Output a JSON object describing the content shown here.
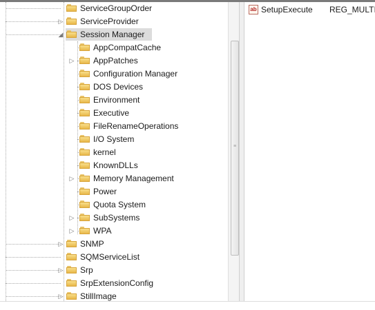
{
  "tree": {
    "items": [
      {
        "label": "ServiceGroupOrder",
        "level": 1,
        "expander": ""
      },
      {
        "label": "ServiceProvider",
        "level": 1,
        "expander": "▷"
      },
      {
        "label": "Session Manager",
        "level": 1,
        "expander": "◢",
        "selected": true
      },
      {
        "label": "AppCompatCache",
        "level": 2,
        "expander": ""
      },
      {
        "label": "AppPatches",
        "level": 2,
        "expander": "▷"
      },
      {
        "label": "Configuration Manager",
        "level": 2,
        "expander": ""
      },
      {
        "label": "DOS Devices",
        "level": 2,
        "expander": ""
      },
      {
        "label": "Environment",
        "level": 2,
        "expander": ""
      },
      {
        "label": "Executive",
        "level": 2,
        "expander": ""
      },
      {
        "label": "FileRenameOperations",
        "level": 2,
        "expander": ""
      },
      {
        "label": "I/O System",
        "level": 2,
        "expander": ""
      },
      {
        "label": "kernel",
        "level": 2,
        "expander": ""
      },
      {
        "label": "KnownDLLs",
        "level": 2,
        "expander": ""
      },
      {
        "label": "Memory Management",
        "level": 2,
        "expander": "▷"
      },
      {
        "label": "Power",
        "level": 2,
        "expander": ""
      },
      {
        "label": "Quota System",
        "level": 2,
        "expander": ""
      },
      {
        "label": "SubSystems",
        "level": 2,
        "expander": "▷"
      },
      {
        "label": "WPA",
        "level": 2,
        "expander": "▷"
      },
      {
        "label": "SNMP",
        "level": 1,
        "expander": "▷"
      },
      {
        "label": "SQMServiceList",
        "level": 1,
        "expander": ""
      },
      {
        "label": "Srp",
        "level": 1,
        "expander": "▷"
      },
      {
        "label": "SrpExtensionConfig",
        "level": 1,
        "expander": ""
      },
      {
        "label": "StillImage",
        "level": 1,
        "expander": "▷"
      }
    ]
  },
  "values": {
    "rows": [
      {
        "icon": "string-value-icon",
        "icon_text": "ab",
        "name": "SetupExecute",
        "type": "REG_MULTI_"
      }
    ]
  },
  "colors": {
    "folder_yellow": "#e9b84a",
    "selected_row": "#dcdcdc",
    "guide_lines": "#a9a9a9"
  },
  "icons": {
    "folder": "folder-icon",
    "expand": "expand-arrow-icon",
    "collapse": "collapse-arrow-icon",
    "scroll_grip": "grip-icon"
  }
}
